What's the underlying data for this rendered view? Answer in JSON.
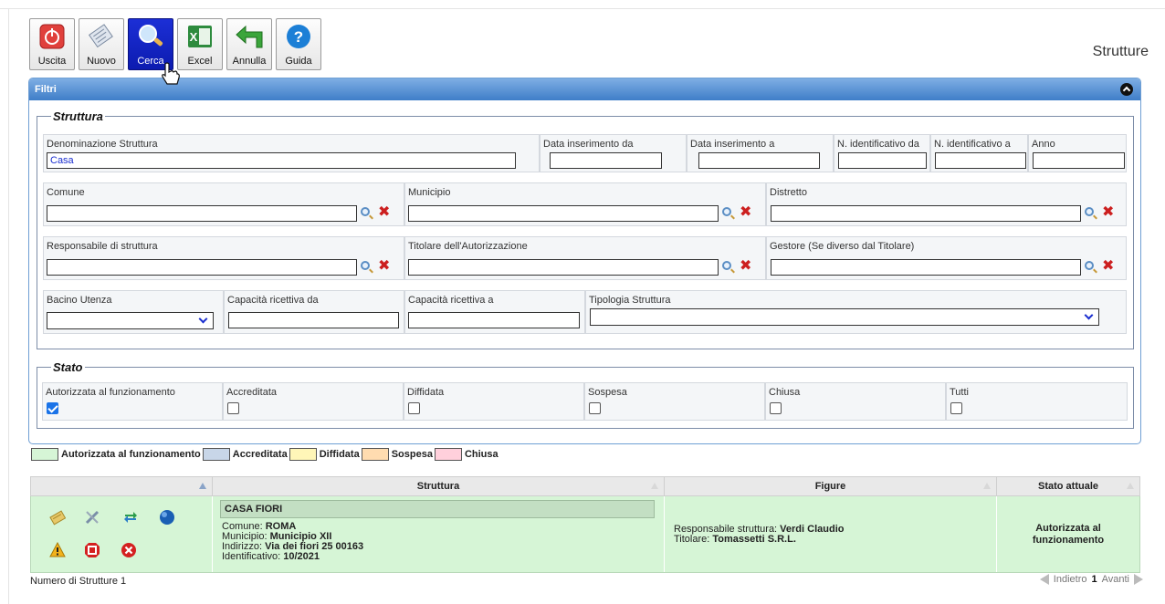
{
  "page_title": "Strutture",
  "toolbar": {
    "uscita": "Uscita",
    "nuovo": "Nuovo",
    "cerca": "Cerca",
    "excel": "Excel",
    "annulla": "Annulla",
    "guida": "Guida"
  },
  "filters": {
    "header": "Filtri",
    "struttura_legend": "Struttura",
    "denominazione_label": "Denominazione Struttura",
    "denominazione_value": "Casa",
    "data_ins_da_label": "Data inserimento da",
    "data_ins_a_label": "Data inserimento a",
    "nid_da_label": "N. identificativo da",
    "nid_a_label": "N. identificativo a",
    "anno_label": "Anno",
    "comune_label": "Comune",
    "municipio_label": "Municipio",
    "distretto_label": "Distretto",
    "responsabile_label": "Responsabile di struttura",
    "titolare_label": "Titolare dell'Autorizzazione",
    "gestore_label": "Gestore (Se diverso dal Titolare)",
    "bacino_label": "Bacino Utenza",
    "cap_da_label": "Capacità ricettiva da",
    "cap_a_label": "Capacità ricettiva a",
    "tipologia_label": "Tipologia Struttura",
    "stato_legend": "Stato",
    "stato_options": [
      {
        "label": "Autorizzata al funzionamento",
        "checked": true
      },
      {
        "label": "Accreditata",
        "checked": false
      },
      {
        "label": "Diffidata",
        "checked": false
      },
      {
        "label": "Sospesa",
        "checked": false
      },
      {
        "label": "Chiusa",
        "checked": false
      },
      {
        "label": "Tutti",
        "checked": false
      }
    ]
  },
  "legend": [
    {
      "label": "Autorizzata al funzionamento",
      "color": "#d6f5d6"
    },
    {
      "label": "Accreditata",
      "color": "#c8d6e8"
    },
    {
      "label": "Diffidata",
      "color": "#fff6b8"
    },
    {
      "label": "Sospesa",
      "color": "#ffdcb0"
    },
    {
      "label": "Chiusa",
      "color": "#ffd0dc"
    }
  ],
  "table": {
    "headers": [
      "",
      "Struttura",
      "Figure",
      "Stato attuale"
    ],
    "row": {
      "name": "CASA FIORI",
      "comune_label": "Comune: ",
      "comune": "ROMA",
      "municipio_label": "Municipio: ",
      "municipio": "Municipio XII",
      "indirizzo_label": "Indirizzo: ",
      "indirizzo": "Via dei fiori 25 00163",
      "identificativo_label": "Identificativo: ",
      "identificativo": "10/2021",
      "responsabile_label": "Responsabile struttura: ",
      "responsabile": "Verdi Claudio",
      "titolare_label": "Titolare: ",
      "titolare": "Tomassetti S.R.L.",
      "stato": "Autorizzata al funzionamento"
    }
  },
  "footer": {
    "count": "Numero di Strutture 1",
    "prev": "Indietro",
    "page": "1",
    "next": "Avanti"
  },
  "icons": {
    "row_actions": [
      "edit-icon",
      "tools-icon",
      "transfer-icon",
      "globe-icon",
      "warning-icon",
      "suspend-icon",
      "close-icon"
    ]
  }
}
